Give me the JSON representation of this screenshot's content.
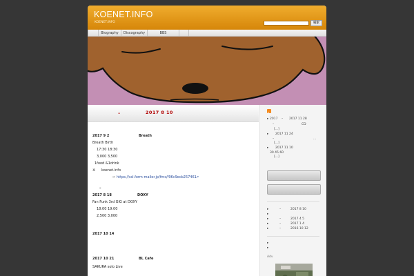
{
  "site": {
    "title": "KOENET.INFO",
    "description": "KOENET.INFO"
  },
  "search": {
    "button_label": "検索"
  },
  "nav": {
    "items": [
      {
        "label": "Biography"
      },
      {
        "label": "Discography"
      },
      {
        "label": "BBS"
      }
    ]
  },
  "post": {
    "date_dash": "–",
    "date": "2017  8   10",
    "entries": [
      {
        "date": "2017  9  2",
        "venue": "Breath"
      },
      {
        "text": "Breath Birth"
      },
      {
        "text": "17:30    18:30"
      },
      {
        "text": "3,000    3,500"
      },
      {
        "text": "1food &1drink"
      },
      {
        "marker": "※",
        "text": "koenet.info"
      },
      {
        "arrow": "→",
        "link": "https://ssl.form-mailer.jp/fms/f96c9ecb257461"
      },
      {
        "dash": "–"
      },
      {
        "date": "2017  8  18",
        "venue": "DOXY"
      },
      {
        "text": "Fan Funk 3rd GIG at DOXY"
      },
      {
        "text": "18:00    19:00"
      },
      {
        "text": "2,500    3,000"
      },
      {
        "date": "2017  10  14"
      },
      {
        "date": "2017  10  21",
        "venue": "BL Cafe"
      },
      {
        "text": "SAKURA solo Live"
      }
    ]
  },
  "sidebar": {
    "feed": [
      {
        "bullet": "▸",
        "a": "2017",
        "b": "–",
        "c": "2017   11   28"
      },
      {
        "a": "–",
        "c": "CD"
      },
      {
        "a": "[...]"
      },
      {
        "bullet": "▸",
        "c": "2017   11   24"
      },
      {
        "a": "–",
        "c": "…"
      },
      {
        "a": "[...]"
      },
      {
        "bullet": "▸",
        "c": "2017   11   10"
      },
      {
        "a": "30   45   60"
      },
      {
        "a": "[...]"
      }
    ],
    "recent": [
      {
        "bullet": "▸",
        "dash": "–",
        "date": "2017  8  10"
      },
      {
        "bullet": "▸"
      },
      {
        "bullet": "▸",
        "dash": "–",
        "date": "2017  4 5"
      },
      {
        "bullet": "▸",
        "dash": "–",
        "date": "2017  1  4"
      },
      {
        "bullet": "▸",
        "dash": "–",
        "date": "2016  10  12"
      }
    ],
    "adv_label": "Adv"
  }
}
